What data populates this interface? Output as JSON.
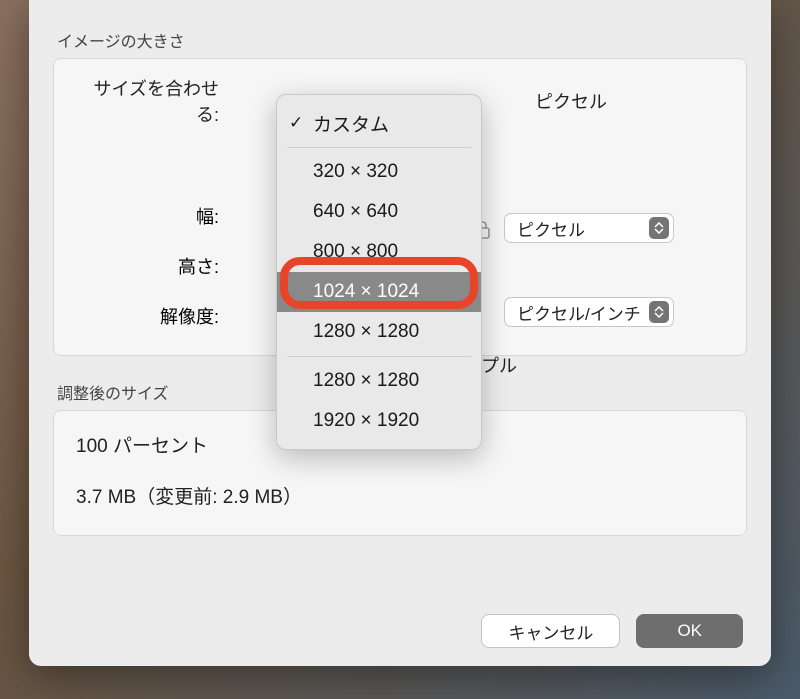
{
  "section_image_size": "イメージの大きさ",
  "fit_label": "サイズを合わせる:",
  "unit_pixel": "ピクセル",
  "width_label": "幅:",
  "height_label": "高さ:",
  "resolution_label": "解像度:",
  "unit_select_pixel": "ピクセル",
  "unit_select_ppi": "ピクセル/インチ",
  "adjusted_size_label": "調整後のサイズ",
  "percent_line": "100 パーセント",
  "filesize_line": "3.7 MB（変更前: 2.9 MB）",
  "cancel_label": "キャンセル",
  "ok_label": "OK",
  "menu": {
    "custom": "カスタム",
    "s320": "320 × 320",
    "s640": "640 × 640",
    "s800": "800 × 800",
    "s1024": "1024 × 1024",
    "s1280a": "1280 × 1280",
    "s1280b": "1280 × 1280",
    "s1920": "1920 × 1920"
  },
  "partial_pl": "プル"
}
